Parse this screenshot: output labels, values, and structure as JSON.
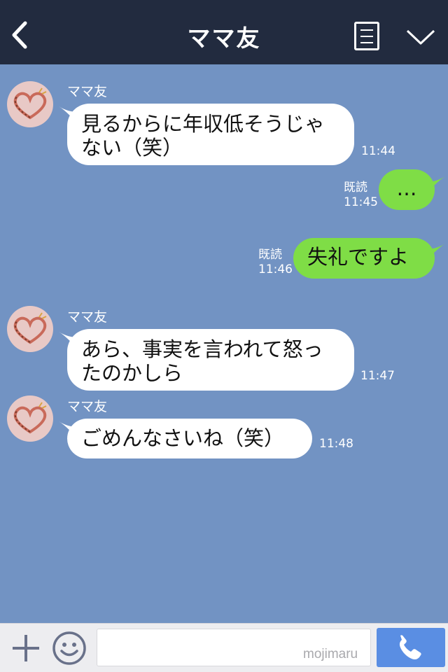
{
  "header": {
    "title": "ママ友"
  },
  "messages": [
    {
      "sender": "ママ友",
      "lines": [
        "見るからに年収低そうじゃ",
        "ない（笑）"
      ],
      "time": "11:44"
    },
    {
      "read": "既読",
      "time": "11:45",
      "text": "…"
    },
    {
      "read": "既読",
      "time": "11:46",
      "text": "失礼ですよ"
    },
    {
      "sender": "ママ友",
      "lines": [
        "あら、事実を言われて怒っ",
        "たのかしら"
      ],
      "time": "11:47"
    },
    {
      "sender": "ママ友",
      "lines": [
        "ごめんなさいね（笑）"
      ],
      "time": "11:48"
    }
  ],
  "input": {
    "watermark": "mojimaru"
  },
  "colors": {
    "header_bg": "#222b3f",
    "chat_bg": "#7293c3",
    "outgoing_bubble": "#7fdd46",
    "incoming_bubble": "#ffffff",
    "call_button": "#5a8ee3"
  },
  "icons": {
    "back": "chevron-left-icon",
    "menu": "list-icon",
    "collapse": "chevron-down-icon",
    "add": "plus-icon",
    "emoji": "smiley-icon",
    "call": "phone-icon"
  }
}
